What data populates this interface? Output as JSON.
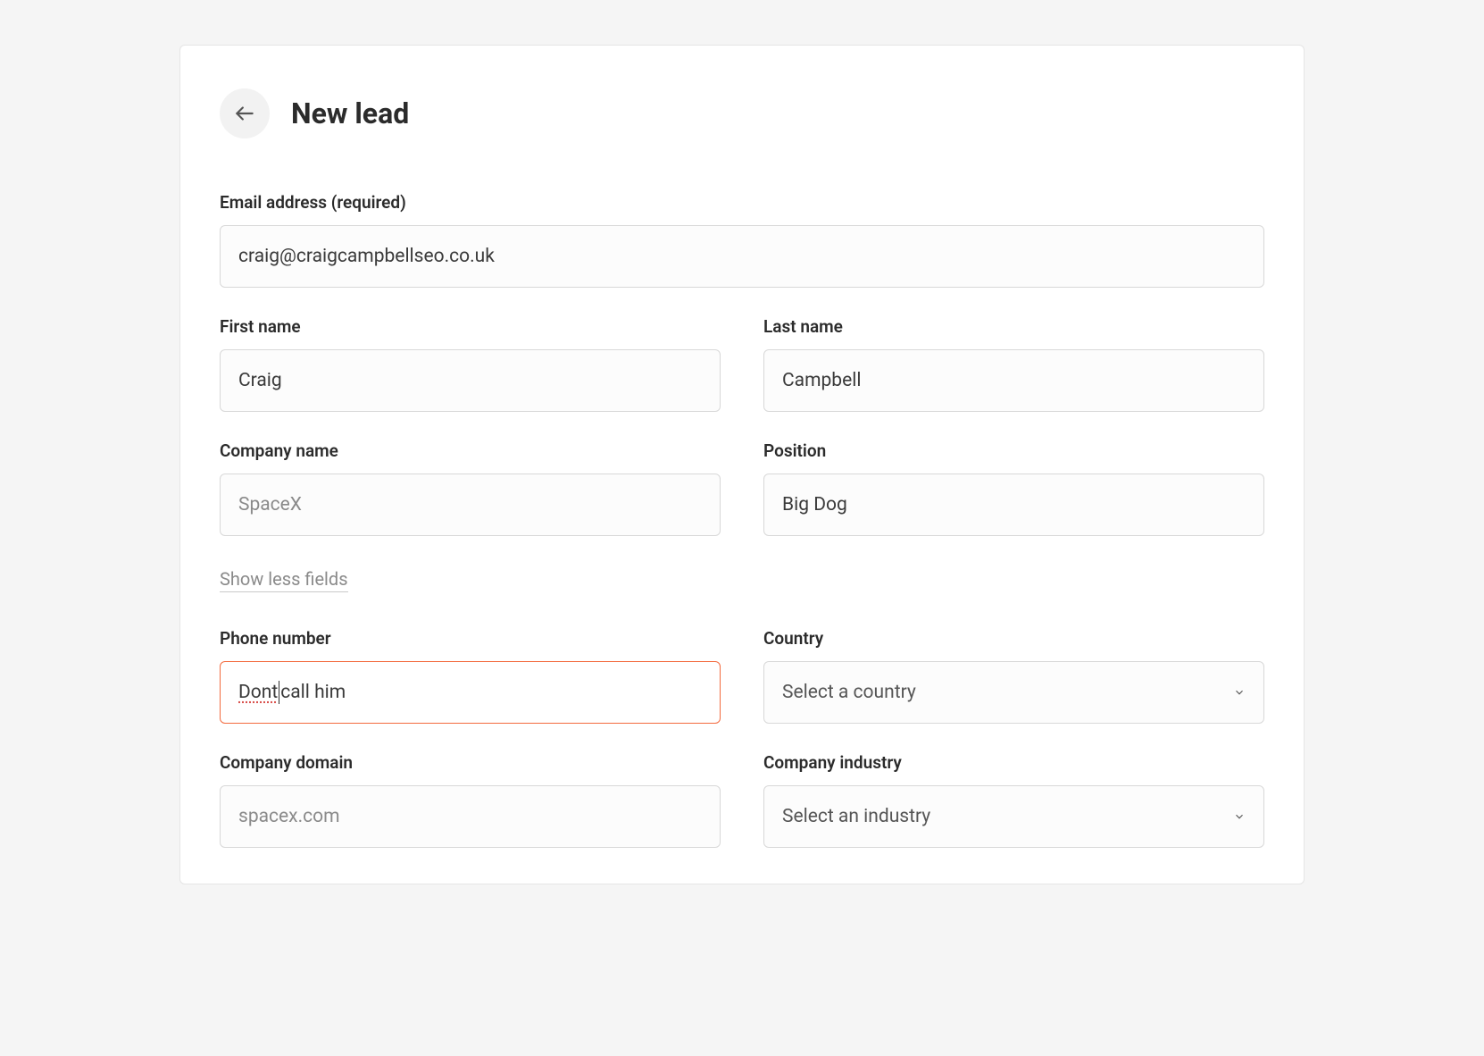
{
  "header": {
    "title": "New lead"
  },
  "form": {
    "email": {
      "label": "Email address (required)",
      "value": "craig@craigcampbellseo.co.uk"
    },
    "first_name": {
      "label": "First name",
      "value": "Craig"
    },
    "last_name": {
      "label": "Last name",
      "value": "Campbell"
    },
    "company_name": {
      "label": "Company name",
      "placeholder": "SpaceX",
      "value": ""
    },
    "position": {
      "label": "Position",
      "value": "Big Dog"
    },
    "toggle_label": "Show less fields",
    "phone": {
      "label": "Phone number",
      "value_prefix": "Dont",
      "value_suffix": " call him"
    },
    "country": {
      "label": "Country",
      "placeholder": "Select a country"
    },
    "company_domain": {
      "label": "Company domain",
      "placeholder": "spacex.com",
      "value": ""
    },
    "company_industry": {
      "label": "Company industry",
      "placeholder": "Select an industry"
    }
  }
}
